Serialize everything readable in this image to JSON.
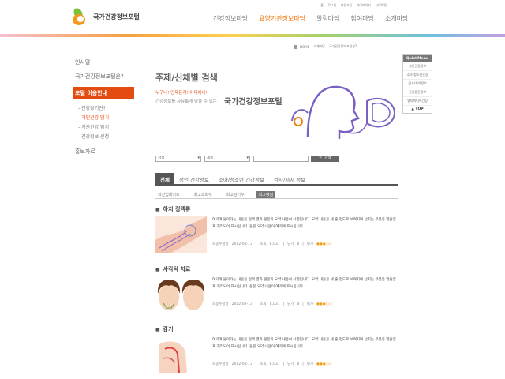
{
  "header": {
    "logo_text": "국가건강정보포털",
    "utility_links": [
      "홈",
      "로그인",
      "회원가입",
      "마이페이지",
      "사이트맵"
    ],
    "nav": [
      {
        "label": "건강정보마당",
        "active": false
      },
      {
        "label": "요양기관정보마당",
        "active": true
      },
      {
        "label": "알림마당",
        "active": false
      },
      {
        "label": "참여마당",
        "active": false
      },
      {
        "label": "소개마당",
        "active": false
      }
    ]
  },
  "breadcrumb": {
    "items": [
      "HOME",
      "소개마당",
      "국가건강정보포털은?"
    ]
  },
  "sidebar": {
    "items": [
      {
        "label": "인사말"
      },
      {
        "label": "국가건강정보포털은?"
      },
      {
        "label": "포털 이용안내"
      }
    ],
    "sub_items": [
      {
        "label": "- 건강당기란?",
        "active": false
      },
      {
        "label": "- 개인건강 담기",
        "active": true
      },
      {
        "label": "- 기관건강 담기",
        "active": false
      },
      {
        "label": "- 건강정보 신청",
        "active": false
      }
    ],
    "extra": "홍보자료"
  },
  "quick_menu": {
    "title": "QuickMenu",
    "items": [
      "성인건강정보",
      "소아/청소년건강",
      "검사/처치정보",
      "건강증진정보",
      "멀티미디어건강"
    ],
    "top_label": "▲ TOP"
  },
  "content": {
    "title": "주제/신체별 검색",
    "banner_tag": "누구나! 언제든지! 어디에나!",
    "banner_desc": "건강정보를 자유롭게 담을 수 있는",
    "banner_brand": "국가건강정보포털"
  },
  "search": {
    "select1": "검색",
    "select2": "제목",
    "button_label": "검색"
  },
  "tabs": [
    {
      "label": "전체",
      "active": true
    },
    {
      "label": "성인 건강정보",
      "active": false
    },
    {
      "label": "소아/청소년 건강정보",
      "active": false
    },
    {
      "label": "검사/처치 정보",
      "active": false
    }
  ],
  "sorts": [
    {
      "label": "최신업데이트",
      "active": false
    },
    {
      "label": "최고조회수",
      "active": false
    },
    {
      "label": "최고담기수",
      "active": false
    },
    {
      "label": "최고평점",
      "active": true
    }
  ],
  "articles": [
    {
      "title": "하지 정맥류",
      "body": "여기에 들어가는 내용은 검색 결과 본문의 요약 내용이 나열됩니다. 요약 내용은 세 줄 정도로 보여지며 넘치는 부분은 말줄임표 처리되어 표시됩니다. 본문 요약 내용이 여기에 표시됩니다.",
      "updated_label": "최종수정일",
      "updated": "2012-08-13",
      "views_label": "조회",
      "views": "8,037",
      "saves_label": "담기",
      "saves": "8",
      "rating_label": "평가",
      "rating": 3
    },
    {
      "title": "사각턱 치료",
      "body": "여기에 들어가는 내용은 검색 결과 본문의 요약 내용이 나열됩니다. 요약 내용은 세 줄 정도로 보여지며 넘치는 부분은 말줄임표 처리되어 표시됩니다. 본문 요약 내용이 여기에 표시됩니다.",
      "updated_label": "최종수정일",
      "updated": "2012-08-13",
      "views_label": "조회",
      "views": "8,037",
      "saves_label": "담기",
      "saves": "8",
      "rating_label": "평가",
      "rating": 3
    },
    {
      "title": "감기",
      "body": "여기에 들어가는 내용은 검색 결과 본문의 요약 내용이 나열됩니다. 요약 내용은 세 줄 정도로 보여지며 넘치는 부분은 말줄임표 처리되어 표시됩니다. 본문 요약 내용이 여기에 표시됩니다.",
      "updated_label": "최종수정일",
      "updated": "2012-08-13",
      "views_label": "조회",
      "views": "8,037",
      "saves_label": "담기",
      "saves": "8",
      "rating_label": "평가",
      "rating": 3
    }
  ],
  "colors": {
    "accent": "#e34b10",
    "nav_active": "#f07000",
    "tab_active": "#555555",
    "star": "#f0a020"
  }
}
